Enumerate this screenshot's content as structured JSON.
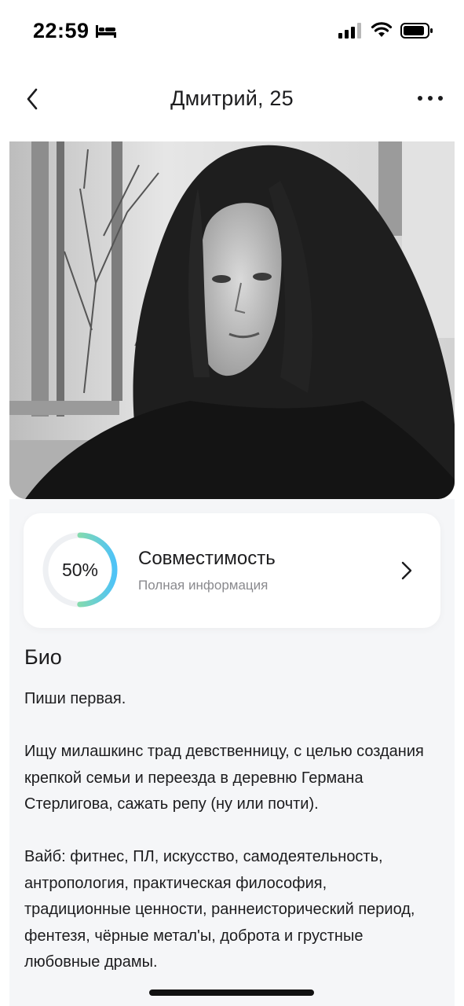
{
  "status_bar": {
    "time": "22:59",
    "icons": [
      "bed-icon",
      "signal-icon",
      "wifi-icon",
      "battery-icon"
    ]
  },
  "header": {
    "title": "Дмитрий, 25",
    "back_icon": "chevron-left-icon",
    "more_icon": "more-dots-icon"
  },
  "photo": {
    "description_icon": "profile-photo"
  },
  "compatibility": {
    "percent_label": "50%",
    "percent_value": 50,
    "title": "Совместимость",
    "subtitle": "Полная информация",
    "ring_colors": [
      "#4fc3f7",
      "#b5f06a"
    ],
    "ring_track_color": "#eef0f3"
  },
  "bio": {
    "heading": "Био",
    "paragraphs": [
      "Пиши первая.",
      "Ищу милашкинс трад девственницу, с целью создания крепкой семьи и переезда в деревню Германа Стерлигова, сажать репу (ну или почти).",
      "Вайб: фитнес, ПЛ, искусство, самодеятельность, антропология, практическая философия, традиционные ценности, раннеисторический период, фентезя, чёрные метал'ы, доброта и грустные любовные драмы."
    ]
  }
}
